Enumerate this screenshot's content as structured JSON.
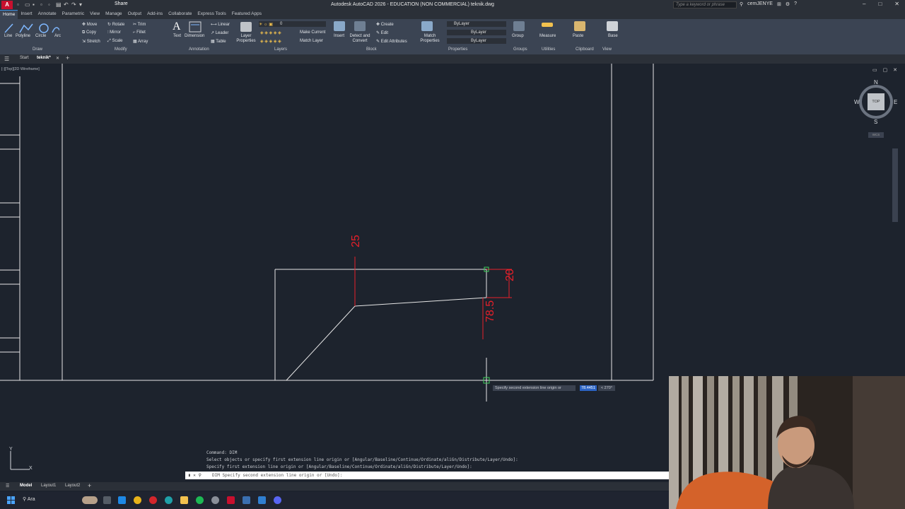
{
  "app": {
    "title": "Autodesk AutoCAD 2026 - EDUCATION (NON COMMERCIAL)   teknik.dwg",
    "logo": "A",
    "share": "Share",
    "search_placeholder": "Type a keyword or phrase",
    "user": "cemJENYE",
    "window_controls": [
      "–",
      "□",
      "✕"
    ]
  },
  "ribbon_tabs": [
    "Home",
    "Insert",
    "Annotate",
    "Parametric",
    "View",
    "Manage",
    "Output",
    "Add-ins",
    "Collaborate",
    "Express Tools",
    "Featured Apps"
  ],
  "ribbon": {
    "draw": {
      "label": "Draw",
      "tools": [
        "Line",
        "Polyline",
        "Circle",
        "Arc"
      ]
    },
    "modify": {
      "label": "Modify",
      "tools": [
        "Move",
        "Rotate",
        "Trim",
        "Copy",
        "Mirror",
        "Fillet",
        "Stretch",
        "Scale",
        "Array"
      ]
    },
    "annotation": {
      "label": "Annotation",
      "tools": [
        "Text",
        "Dimension",
        "Linear",
        "Leader",
        "Table"
      ]
    },
    "layers": {
      "label": "Layers",
      "tools": [
        "Layer Properties",
        "Make Current",
        "Match Layer"
      ],
      "current_layer": "0"
    },
    "block": {
      "label": "Block",
      "tools": [
        "Insert",
        "Detect and Convert",
        "Create",
        "Edit",
        "Edit Attributes"
      ]
    },
    "properties": {
      "label": "Properties",
      "tools": [
        "Match Properties"
      ],
      "color": "ByLayer",
      "linetype": "ByLayer",
      "lineweight": "ByLayer"
    },
    "groups": {
      "label": "Groups",
      "tools": [
        "Group"
      ]
    },
    "utilities": {
      "label": "Utilities",
      "tools": [
        "Measure"
      ]
    },
    "clipboard": {
      "label": "Clipboard",
      "tools": [
        "Paste"
      ]
    },
    "view": {
      "label": "View",
      "tools": [
        "Base"
      ]
    }
  },
  "doc_tabs": [
    "Start",
    "teknik*"
  ],
  "viewport": {
    "label": "[-][Top][2D Wireframe]",
    "compass": {
      "n": "N",
      "s": "S",
      "e": "E",
      "w": "W",
      "top": "TOP"
    },
    "wcs": "WCS"
  },
  "dimensions": [
    "25",
    "20",
    "78.5"
  ],
  "tooltip": {
    "prompt": "Specify second extension line origin or",
    "value": "78.4451",
    "angle": "< 270°"
  },
  "command": {
    "history": [
      "Command: DIM",
      "Select objects or specify first extension line origin or [Angular/Baseline/Continue/Ordinate/aliGn/Distribute/Layer/Undo]:",
      "Specify first extension line origin or [Angular/Baseline/Continue/Ordinate/aliGn/Distribute/Layer/Undo]:"
    ],
    "current": "DIM Specify second extension line origin or [Undo]:"
  },
  "layout_tabs": [
    "Model",
    "Layout1",
    "Layout2"
  ],
  "taskbar": {
    "search": "Ara"
  },
  "colors": {
    "dimension": "#e8202a",
    "background": "#1d232d",
    "ribbon": "#3b4453",
    "geometry": "#e6e6e6"
  }
}
